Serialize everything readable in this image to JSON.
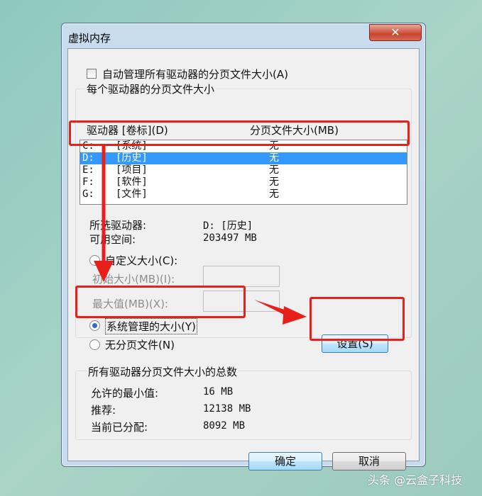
{
  "window": {
    "title": "虚拟内存",
    "close_glyph": "✕"
  },
  "auto_manage": {
    "label": "自动管理所有驱动器的分页文件大小(A)",
    "checked": false
  },
  "per_drive_group": {
    "label": "每个驱动器的分页文件大小",
    "col_drive": "驱动器 [卷标](D)",
    "col_size": "分页文件大小(MB)",
    "drives": [
      {
        "drive": "C:",
        "label": "[系统]",
        "size": "无"
      },
      {
        "drive": "D:",
        "label": "[历史]",
        "size": "无",
        "selected": true
      },
      {
        "drive": "E:",
        "label": "[项目]",
        "size": "无"
      },
      {
        "drive": "F:",
        "label": "[软件]",
        "size": "无"
      },
      {
        "drive": "G:",
        "label": "[文件]",
        "size": "无"
      }
    ]
  },
  "selected_info": {
    "drive_label": "所选驱动器:",
    "drive_value": "D:  [历史]",
    "space_label": "可用空间:",
    "space_value": "203497 MB"
  },
  "options": {
    "custom_size": "自定义大小(C):",
    "initial_size": "初始大小(MB)(I):",
    "max_size": "最大值(MB)(X):",
    "system_managed": "系统管理的大小(Y)",
    "no_paging": "无分页文件(N)",
    "selected": "system_managed",
    "set_button": "设置(S)"
  },
  "totals_group": {
    "label": "所有驱动器分页文件大小的总数",
    "min_label": "允许的最小值:",
    "min_value": "16 MB",
    "recommended_label": "推荐:",
    "recommended_value": "12138 MB",
    "current_label": "当前已分配:",
    "current_value": "8092 MB"
  },
  "footer": {
    "ok": "确定",
    "cancel": "取消"
  },
  "annotation_color": "#e8201a",
  "watermark": "头条 @云盒子科技"
}
